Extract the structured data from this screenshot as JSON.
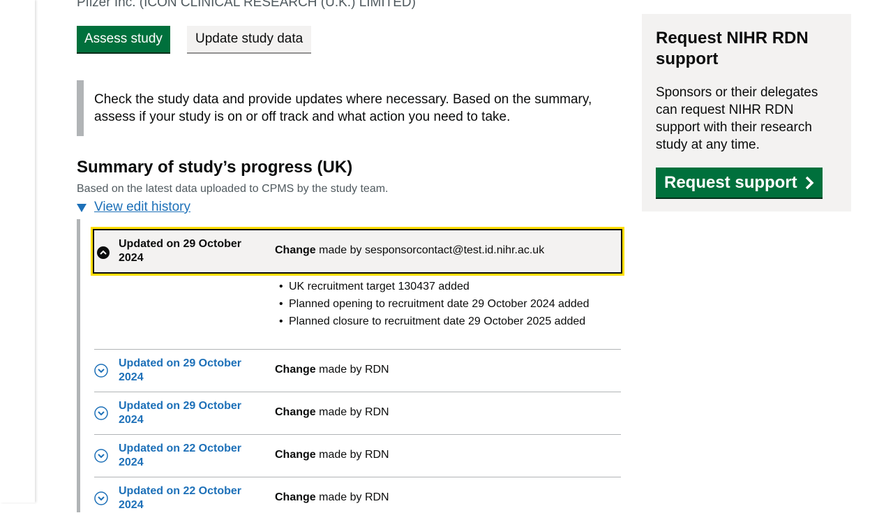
{
  "sponsor_line": "Pfizer Inc. (ICON CLINICAL RESEARCH (U.K.) LIMITED)",
  "actions": {
    "assess_label": "Assess study",
    "update_label": "Update study data"
  },
  "inset_text": "Check the study data and provide updates where necessary. Based on the summary, assess if your study is on or off track and what action you need to take.",
  "summary": {
    "title": "Summary of study’s progress (UK)",
    "hint": "Based on the latest data uploaded to CPMS by the study team.",
    "history_link": "View edit history"
  },
  "history": {
    "change_label": "Change",
    "open_entry": {
      "date": "Updated on 29 October 2024",
      "made_by": "made by sesponsorcontact@test.id.nihr.ac.uk",
      "changes": [
        "UK recruitment target 130437 added",
        "Planned opening to recruitment date 29 October 2024 added",
        "Planned closure to recruitment date 29 October 2025 added"
      ]
    },
    "entries": [
      {
        "date": "Updated on 29 October 2024",
        "made_by": "made by RDN"
      },
      {
        "date": "Updated on 29 October 2024",
        "made_by": "made by RDN"
      },
      {
        "date": "Updated on 22 October 2024",
        "made_by": "made by RDN"
      },
      {
        "date": "Updated on 22 October 2024",
        "made_by": "made by RDN"
      }
    ]
  },
  "panel": {
    "title": "Request NIHR RDN support",
    "body": "Sponsors or their delegates can request NIHR RDN support with their research study at any time.",
    "button_label": "Request support"
  },
  "colors": {
    "primary_green": "#00703c",
    "link_blue": "#1d70b8",
    "focus_yellow": "#ffdd00",
    "panel_grey": "#f3f2f1"
  },
  "icons": {
    "open_entry": "chevron-up-circle-icon",
    "closed_entry": "chevron-down-circle-icon",
    "details": "triangle-down-icon",
    "request": "chevron-right-icon"
  }
}
